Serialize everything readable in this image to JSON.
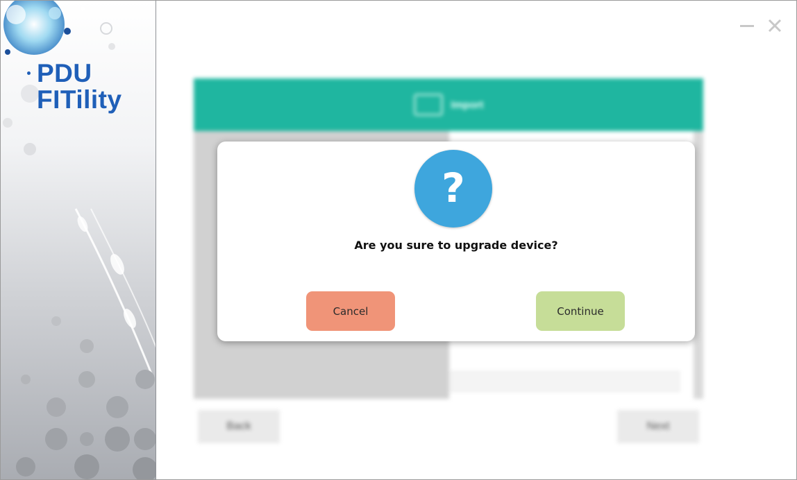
{
  "app": {
    "brand_line1": "PDU",
    "brand_line2": "FITility",
    "brand_color": "#1f5fb8"
  },
  "window_controls": {
    "minimize_icon": "minimize-icon",
    "close_icon": "close-icon"
  },
  "background": {
    "header_title": "Import",
    "header_color": "#14b39b",
    "back_label": "Back",
    "next_label": "Next"
  },
  "dialog": {
    "icon": "question-icon",
    "icon_glyph": "?",
    "icon_color": "#3ea6dd",
    "message": "Are you sure to upgrade device?",
    "cancel_label": "Cancel",
    "cancel_color": "#f09478",
    "continue_label": "Continue",
    "continue_color": "#c6dd98"
  }
}
